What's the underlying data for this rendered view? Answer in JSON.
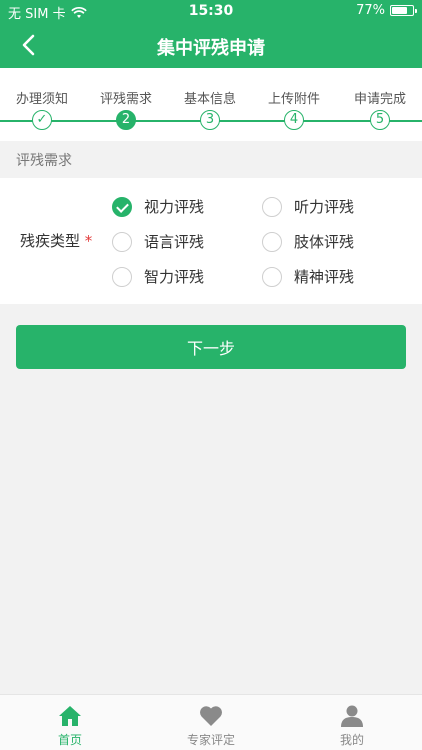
{
  "status_bar": {
    "carrier": "无 SIM 卡",
    "time": "15:30",
    "battery": "77%",
    "battery_level": 0.77
  },
  "header": {
    "title": "集中评残申请"
  },
  "steps": [
    {
      "label": "办理须知",
      "marker": "✓"
    },
    {
      "label": "评残需求",
      "marker": "2",
      "active": true
    },
    {
      "label": "基本信息",
      "marker": "3"
    },
    {
      "label": "上传附件",
      "marker": "4"
    },
    {
      "label": "申请完成",
      "marker": "5"
    }
  ],
  "section": {
    "title": "评残需求"
  },
  "form": {
    "label": "残疾类型",
    "required_mark": "*",
    "options": [
      {
        "label": "视力评残",
        "checked": true
      },
      {
        "label": "听力评残",
        "checked": false
      },
      {
        "label": "语言评残",
        "checked": false
      },
      {
        "label": "肢体评残",
        "checked": false
      },
      {
        "label": "智力评残",
        "checked": false
      },
      {
        "label": "精神评残",
        "checked": false
      }
    ]
  },
  "next_button": {
    "label": "下一步"
  },
  "tabbar": {
    "items": [
      {
        "label": "首页",
        "icon": "home-icon",
        "active": true
      },
      {
        "label": "专家评定",
        "icon": "heart-icon",
        "active": false
      },
      {
        "label": "我的",
        "icon": "user-icon",
        "active": false
      }
    ]
  },
  "colors": {
    "primary": "#27b36a",
    "background": "#f2f2f2",
    "required": "#e23a3a"
  }
}
